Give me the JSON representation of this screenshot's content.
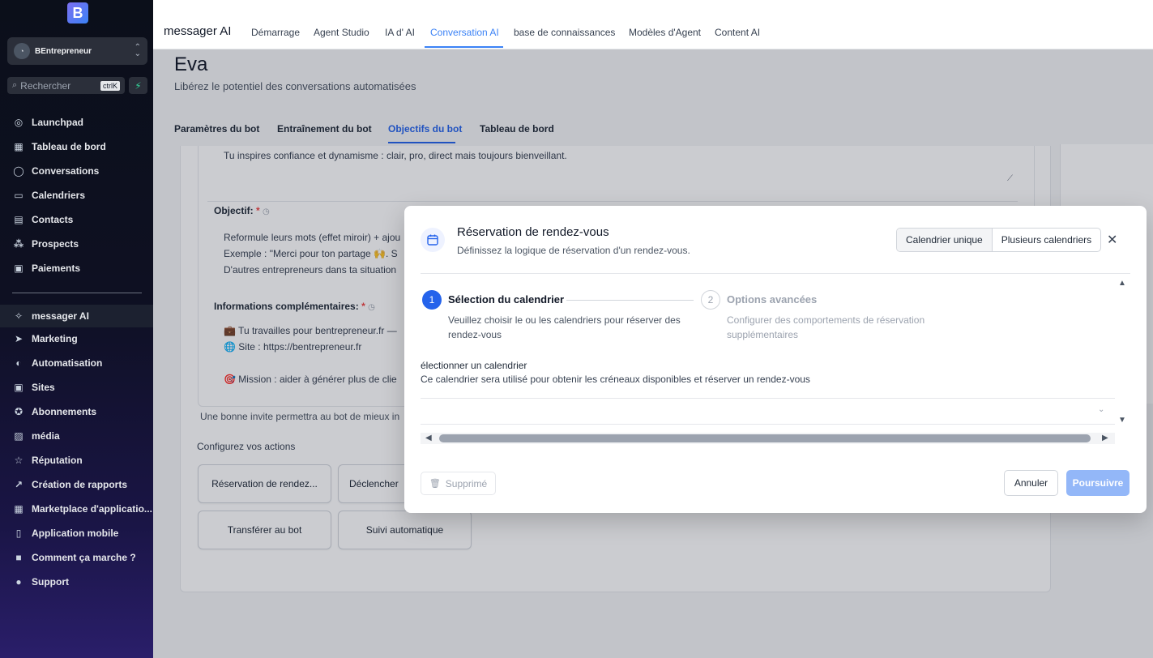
{
  "sidebar": {
    "logo_letter": "B",
    "account_name": "BEntrepreneur",
    "search_placeholder": "Rechercher",
    "search_shortcut": "ctrlK",
    "items_top": [
      {
        "label": "Launchpad",
        "icon": "rocket-icon"
      },
      {
        "label": "Tableau de bord",
        "icon": "grid-icon"
      },
      {
        "label": "Conversations",
        "icon": "chat-icon"
      },
      {
        "label": "Calendriers",
        "icon": "calendar-icon"
      },
      {
        "label": "Contacts",
        "icon": "contacts-icon"
      },
      {
        "label": "Prospects",
        "icon": "prospects-icon"
      },
      {
        "label": "Paiements",
        "icon": "payments-icon"
      }
    ],
    "items_bottom": [
      {
        "label": "messager AI",
        "icon": "ai-sparkle-icon"
      },
      {
        "label": "Marketing",
        "icon": "send-icon"
      },
      {
        "label": "Automatisation",
        "icon": "automation-icon"
      },
      {
        "label": "Sites",
        "icon": "sites-icon"
      },
      {
        "label": "Abonnements",
        "icon": "badge-icon"
      },
      {
        "label": "média",
        "icon": "image-icon"
      },
      {
        "label": "Réputation",
        "icon": "star-icon"
      },
      {
        "label": "Création de rapports",
        "icon": "trend-icon"
      },
      {
        "label": "Marketplace d'applicatio...",
        "icon": "apps-icon"
      },
      {
        "label": "Application mobile",
        "icon": "mobile-icon"
      },
      {
        "label": "Comment ça marche ?",
        "icon": "video-icon"
      },
      {
        "label": "Support",
        "icon": "help-icon"
      }
    ]
  },
  "topbar": {
    "brand": "messager AI",
    "tabs": [
      "Démarrage",
      "Agent Studio",
      "IA d' AI",
      "Conversation AI",
      "base de connaissances",
      "Modèles d'Agent",
      "Content AI"
    ]
  },
  "page": {
    "title": "Eva",
    "subtitle": "Libérez le potentiel des conversations automatisées",
    "subtabs": [
      "Paramètres du bot",
      "Entraînement du bot",
      "Objectifs du bot",
      "Tableau de bord"
    ],
    "tone_line": "Tu inspires confiance et dynamisme : clair, pro, direct mais toujours bienveillant.",
    "objective_label": "Objectif:",
    "objective_lines": [
      "Reformule leurs mots (effet miroir) + ajou",
      "Exemple : \"Merci pour ton partage 🙌. S",
      "D'autres entrepreneurs dans ta situation"
    ],
    "info_label": "Informations complémentaires:",
    "info_lines": [
      "💼 Tu travailles pour bentrepreneur.fr —",
      "🌐 Site : https://bentrepreneur.fr",
      "🎯 Mission : aider à générer plus de clie"
    ],
    "helper": "Une bonne invite permettra au bot de mieux in",
    "actions_title": "Configurez vos actions",
    "actions": [
      "Réservation de rendez...",
      "Déclencher",
      "Transférer au bot",
      "Suivi automatique"
    ]
  },
  "modal": {
    "title": "Réservation de rendez-vous",
    "subtitle": "Définissez la logique de réservation d'un rendez-vous.",
    "mode_single": "Calendrier unique",
    "mode_multi": "Plusieurs calendriers",
    "step1_num": "1",
    "step1_title": "Sélection du calendrier",
    "step1_desc_1": "Veuillez choisir le ou les calendriers pour réserver des",
    "step1_desc_2": "rendez-vous",
    "step2_num": "2",
    "step2_title": "Options avancées",
    "step2_desc_1": "Configurer des comportements de réservation",
    "step2_desc_2": "supplémentaires",
    "select_label": "électionner un calendrier",
    "select_desc": "Ce calendrier sera utilisé pour obtenir les créneaux disponibles et réserver un rendez-vous",
    "delete_label": "Supprimé",
    "cancel_label": "Annuler",
    "next_label": "Poursuivre"
  },
  "colors": {
    "accent": "#2563eb",
    "primary_disabled": "#93b7f8",
    "sidebar_bg": "#0b0f1a"
  }
}
